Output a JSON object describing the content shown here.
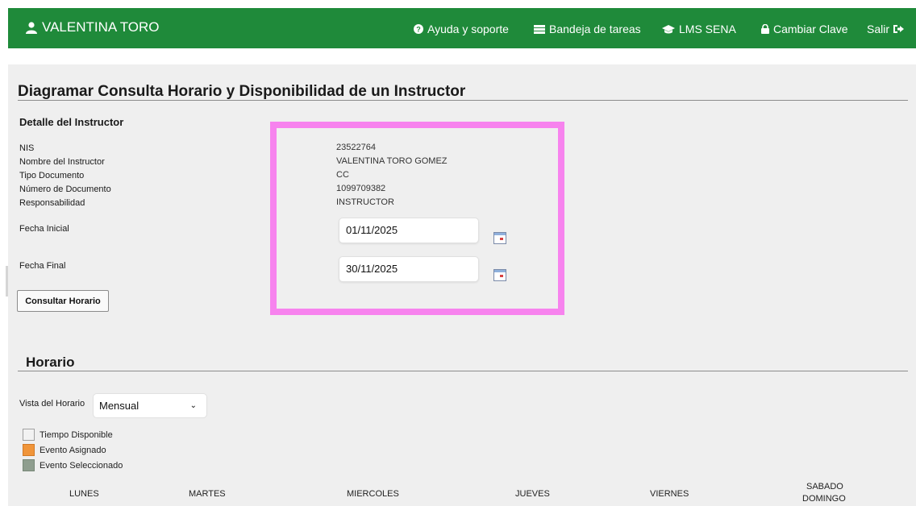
{
  "header": {
    "user_name": "VALENTINA TORO",
    "nav": [
      {
        "label": "Ayuda y soporte",
        "icon": "question-circle-icon"
      },
      {
        "label": "Bandeja de tareas",
        "icon": "inbox-tray-icon"
      },
      {
        "label": "LMS SENA",
        "icon": "graduation-cap-icon"
      },
      {
        "label": "Cambiar Clave",
        "icon": "lock-icon"
      },
      {
        "label": "Salir",
        "icon": "sign-out-icon"
      }
    ],
    "bg_color": "#1f8a3a"
  },
  "page": {
    "title": "Diagramar Consulta Horario y Disponibilidad de un Instructor",
    "detail_title": "Detalle del Instructor"
  },
  "instructor": {
    "labels": [
      "NIS",
      "Nombre del Instructor",
      "Tipo Documento",
      "Número de Documento",
      "Responsabilidad"
    ],
    "values": [
      "23522764",
      "VALENTINA TORO GOMEZ",
      "CC",
      "1099709382",
      "INSTRUCTOR"
    ]
  },
  "dates": {
    "start_label": "Fecha Inicial",
    "start_value": "01/11/2025",
    "end_label": "Fecha Final",
    "end_value": "30/11/2025"
  },
  "consult_button": "Consultar Horario",
  "schedule": {
    "title": "Horario",
    "view_label": "Vista del Horario",
    "view_value": "Mensual",
    "legend": [
      {
        "label": "Tiempo Disponible",
        "color": "#f2f2f2"
      },
      {
        "label": "Evento Asignado",
        "color": "#f0953a"
      },
      {
        "label": "Evento Seleccionado",
        "color": "#8f9e8f"
      }
    ],
    "days": [
      "LUNES",
      "MARTES",
      "MIERCOLES",
      "JUEVES",
      "VIERNES",
      "SABADO",
      "DOMINGO"
    ]
  },
  "highlight_color": "#f783ee"
}
